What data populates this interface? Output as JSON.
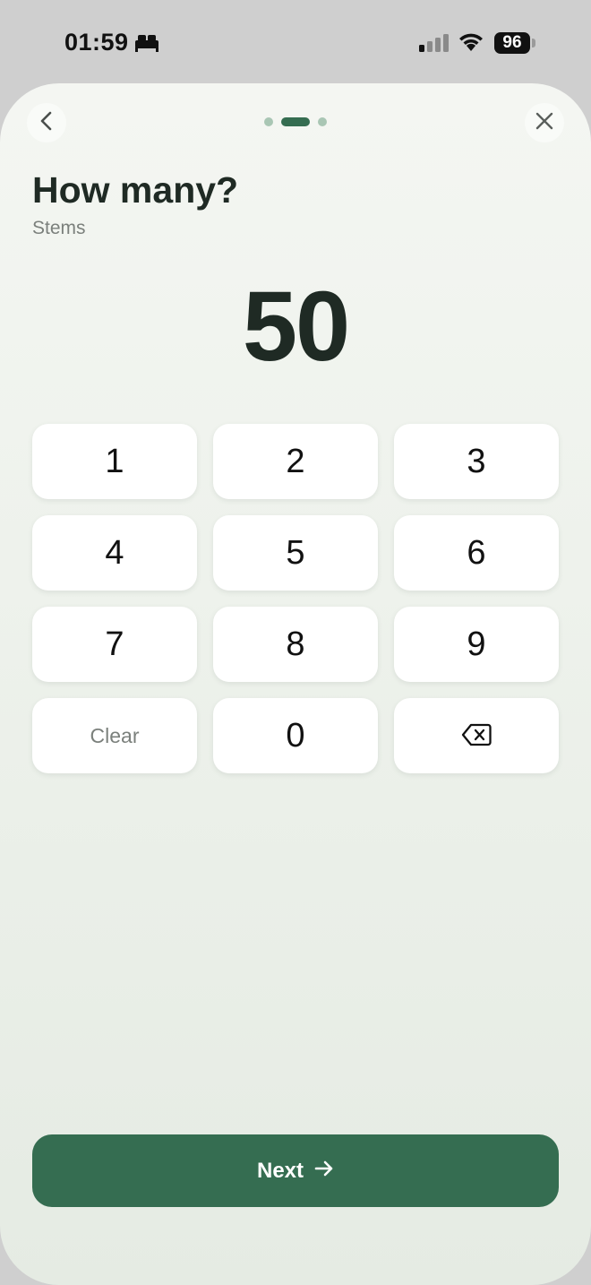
{
  "status_bar": {
    "time": "01:59",
    "battery": "96",
    "icons": [
      "bed-icon",
      "cellular-signal-icon",
      "wifi-icon",
      "battery-icon"
    ]
  },
  "header": {
    "back_icon": "chevron-left-icon",
    "close_icon": "close-icon",
    "progress": {
      "total_steps": 3,
      "current_step": 2
    }
  },
  "content": {
    "title": "How many?",
    "subtitle": "Stems",
    "value": "50"
  },
  "keypad": {
    "keys": [
      "1",
      "2",
      "3",
      "4",
      "5",
      "6",
      "7",
      "8",
      "9"
    ],
    "clear_label": "Clear",
    "zero_label": "0",
    "backspace_icon": "backspace-icon"
  },
  "footer": {
    "next_label": "Next",
    "next_icon": "arrow-right-icon"
  },
  "colors": {
    "accent": "#356d51",
    "text": "#1f2a24",
    "muted": "#7b807c"
  }
}
